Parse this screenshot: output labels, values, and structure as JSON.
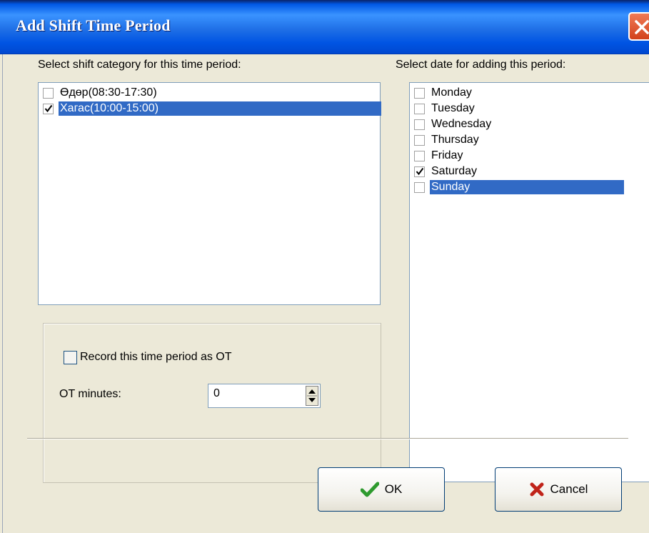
{
  "window": {
    "title": "Add Shift Time Period",
    "close_icon": "close-icon"
  },
  "shift_category": {
    "label": "Select shift category for this time period:",
    "items": [
      {
        "label": "Өдөр(08:30-17:30)",
        "checked": false,
        "selected": false
      },
      {
        "label": "Хагас(10:00-15:00)",
        "checked": true,
        "selected": true
      }
    ]
  },
  "dates": {
    "label": "Select date for adding this period:",
    "items": [
      {
        "label": "Monday",
        "checked": false,
        "selected": false
      },
      {
        "label": "Tuesday",
        "checked": false,
        "selected": false
      },
      {
        "label": "Wednesday",
        "checked": false,
        "selected": false
      },
      {
        "label": "Thursday",
        "checked": false,
        "selected": false
      },
      {
        "label": "Friday",
        "checked": false,
        "selected": false
      },
      {
        "label": "Saturday",
        "checked": true,
        "selected": false
      },
      {
        "label": "Sunday",
        "checked": false,
        "selected": true
      }
    ]
  },
  "overtime": {
    "record_label": "Record this time period as OT",
    "record_checked": false,
    "minutes_label": "OT minutes:",
    "minutes_value": "0"
  },
  "buttons": {
    "ok_label": "OK",
    "ok_icon": "checkmark-icon",
    "cancel_label": "Cancel",
    "cancel_icon": "x-icon"
  },
  "colors": {
    "selection": "#316ac5",
    "titlebar": "#0054e3",
    "dialog_bg": "#ece9d8",
    "ok_icon": "#2e9a2e",
    "cancel_icon": "#c0241a"
  }
}
